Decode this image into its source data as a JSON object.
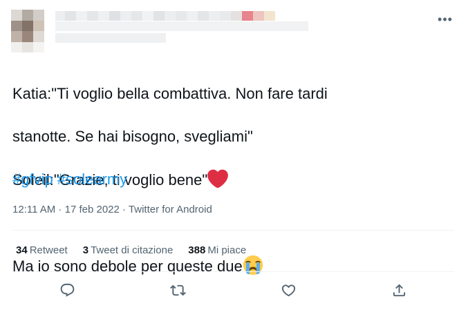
{
  "tweet": {
    "lines": [
      "Katia:\"Ti voglio bella combattiva. Non fare tardi",
      "stanotte. Se hai bisogno, svegliami\"",
      "Soleil:\"Grazie, ti voglio bene\""
    ],
    "line4": "Ma io sono debole per queste due",
    "hashtags": [
      "#gfvip",
      "#solearmy"
    ],
    "emoji_heart": "red-heart-emoji",
    "emoji_cry": "loudly-crying-face-emoji"
  },
  "meta": {
    "time": "12:11 AM",
    "sep1": " · ",
    "date": "17 feb 2022",
    "sep2": " · ",
    "source": "Twitter for Android"
  },
  "stats": {
    "retweets_count": "34",
    "retweets_label": "Retweet",
    "quotes_count": "3",
    "quotes_label": "Tweet di citazione",
    "likes_count": "388",
    "likes_label": "Mi piace"
  },
  "actions": [
    "reply-icon",
    "retweet-icon",
    "like-icon",
    "share-icon"
  ],
  "colors": {
    "text": "#0f1419",
    "muted": "#536471",
    "link": "#1d9bf0",
    "heart": "#e0245e",
    "divider": "#eff3f4"
  }
}
